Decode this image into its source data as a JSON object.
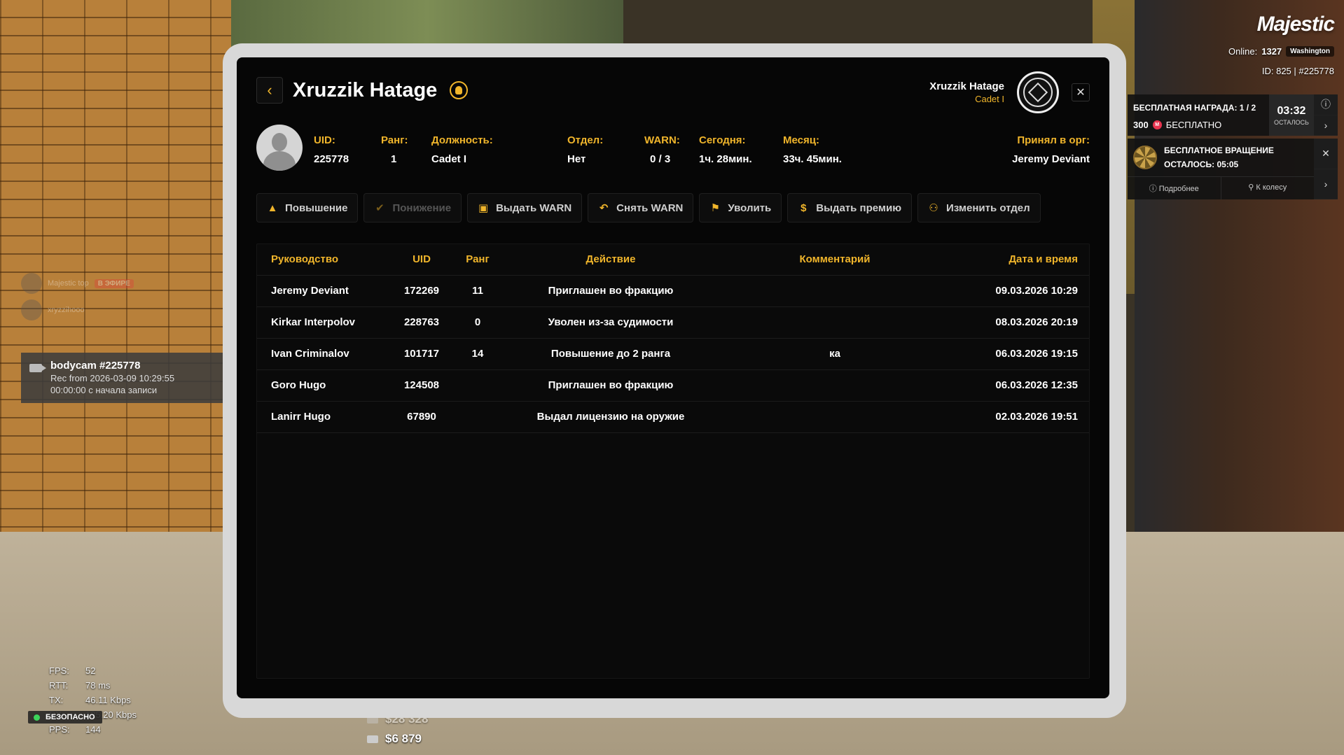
{
  "hud": {
    "brand": "Majestic",
    "online_label": "Online:",
    "online_count": "1327",
    "city": "Washington",
    "id_line": "ID: 825 | #225778",
    "reward": {
      "title": "БЕСПЛАТНАЯ НАГРАДА:",
      "progress": "1 / 2",
      "amount": "300",
      "coin_icon": "majestic-coin-icon",
      "free_label": "БЕСПЛАТНО",
      "timer": "03:32",
      "timer_label": "ОСТАЛОСЬ"
    },
    "spin": {
      "title": "БЕСПЛАТНОЕ ВРАЩЕНИЕ",
      "remaining_label": "ОСТАЛОСЬ:",
      "remaining_time": "05:05",
      "more_label": "Подробнее",
      "wheel_label": "К колесу"
    },
    "stream": {
      "channel": "Majestic top",
      "live_label": "В ЭФИРЕ",
      "viewer": "xryzzihooo"
    },
    "bodycam": {
      "title": "bodycam #225778",
      "rec_line": "Rec from 2026-03-09 10:29:55",
      "elapsed_line": "00:00:00 с начала записи"
    },
    "netstats": [
      {
        "k": "FPS:",
        "v": "52"
      },
      {
        "k": "RTT:",
        "v": "78 ms"
      },
      {
        "k": "TX:",
        "v": "46.11 Kbps"
      },
      {
        "k": "RX:",
        "v": "125.20 Kbps"
      },
      {
        "k": "PPS:",
        "v": "144"
      }
    ],
    "safe_label": "БЕЗОПАСНО",
    "money": {
      "bank": "$28 328",
      "cash": "$6 879"
    }
  },
  "tablet": {
    "back_icon": "chevron-left-icon",
    "title": "Xruzzik Hatage",
    "header_name": "Xruzzik Hatage",
    "header_rank": "Cadet I",
    "close_icon": "close-icon",
    "profile": {
      "uid_label": "UID:",
      "uid": "225778",
      "rank_label": "Ранг:",
      "rank": "1",
      "position_label": "Должность:",
      "position": "Cadet I",
      "dept_label": "Отдел:",
      "dept": "Нет",
      "warn_label": "WARN:",
      "warn": "0 / 3",
      "today_label": "Сегодня:",
      "today": "1ч. 28мин.",
      "month_label": "Месяц:",
      "month": "33ч. 45мин.",
      "accepted_label": "Принял в орг:",
      "accepted_by": "Jeremy Deviant"
    },
    "actions": [
      {
        "label": "Повышение",
        "icon": "chevron-up-icon",
        "glyph": "▲",
        "enabled": true
      },
      {
        "label": "Понижение",
        "icon": "chevron-down-icon",
        "glyph": "✔",
        "enabled": false
      },
      {
        "label": "Выдать WARN",
        "icon": "warn-doc-icon",
        "glyph": "▣",
        "enabled": true
      },
      {
        "label": "Снять WARN",
        "icon": "undo-icon",
        "glyph": "↶",
        "enabled": true
      },
      {
        "label": "Уволить",
        "icon": "dismiss-icon",
        "glyph": "⚑",
        "enabled": true
      },
      {
        "label": "Выдать премию",
        "icon": "bonus-coin-icon",
        "glyph": "$",
        "enabled": true
      },
      {
        "label": "Изменить отдел",
        "icon": "org-icon",
        "glyph": "⚇",
        "enabled": true
      }
    ],
    "table": {
      "headers": [
        "Руководство",
        "UID",
        "Ранг",
        "Действие",
        "Комментарий",
        "Дата и время"
      ],
      "rows": [
        {
          "leader": "Jeremy Deviant",
          "uid": "172269",
          "rank": "11",
          "action": "Приглашен во фракцию",
          "comment": "",
          "date": "09.03.2026 10:29"
        },
        {
          "leader": "Kirkar Interpolov",
          "uid": "228763",
          "rank": "0",
          "action": "Уволен из-за судимости",
          "comment": "",
          "date": "08.03.2026 20:19"
        },
        {
          "leader": "Ivan Criminalov",
          "uid": "101717",
          "rank": "14",
          "action": "Повышение до 2 ранга",
          "comment": "ка",
          "date": "06.03.2026 19:15"
        },
        {
          "leader": "Goro Hugo",
          "uid": "124508",
          "rank": "",
          "action": "Приглашен во фракцию",
          "comment": "",
          "date": "06.03.2026 12:35"
        },
        {
          "leader": "Lanirr Hugo",
          "uid": "67890",
          "rank": "",
          "action": "Выдал лицензию на оружие",
          "comment": "",
          "date": "02.03.2026 19:51"
        }
      ]
    }
  }
}
